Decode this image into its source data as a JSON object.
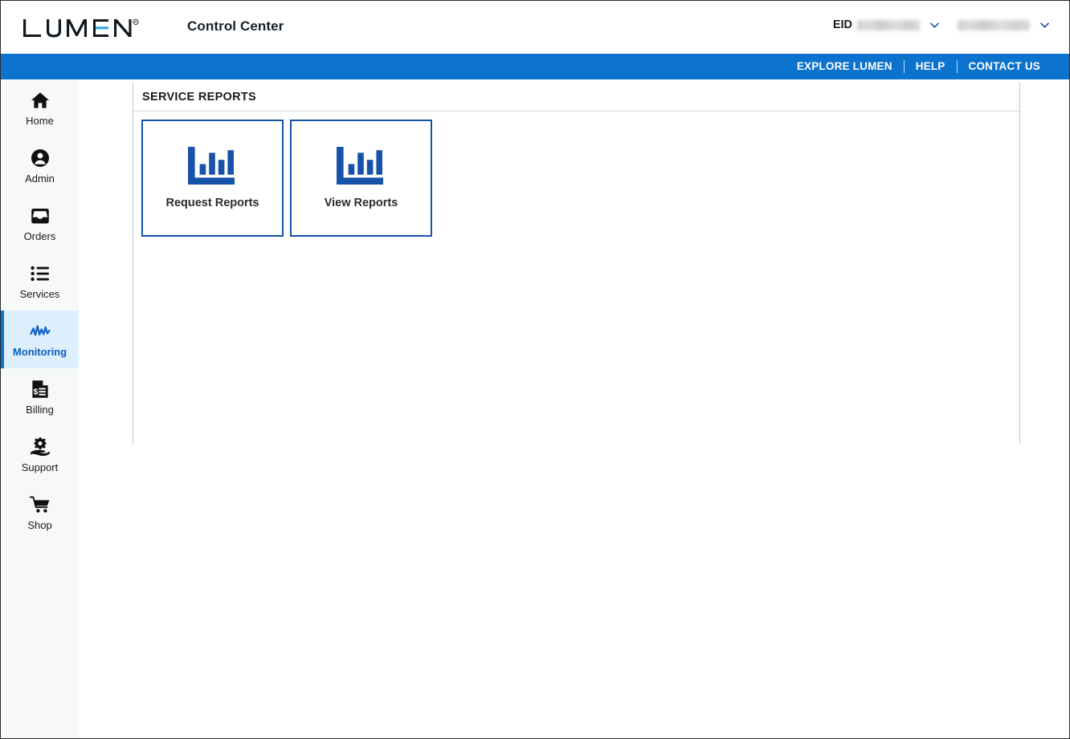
{
  "header": {
    "logo_text": "LUMEN",
    "logo_registered": "®",
    "app_title": "Control Center",
    "eid_label": "EID",
    "eid_value": "",
    "user_value": "",
    "eid_caret": "chevron-down-icon",
    "user_caret": "chevron-down-icon"
  },
  "utility_nav": {
    "items": [
      {
        "label": "EXPLORE LUMEN"
      },
      {
        "label": "HELP"
      },
      {
        "label": "CONTACT US"
      }
    ]
  },
  "sidebar": {
    "items": [
      {
        "label": "Home",
        "icon": "home-icon",
        "active": false
      },
      {
        "label": "Admin",
        "icon": "user-circle-icon",
        "active": false
      },
      {
        "label": "Orders",
        "icon": "inbox-tray-icon",
        "active": false
      },
      {
        "label": "Services",
        "icon": "list-icon",
        "active": false
      },
      {
        "label": "Monitoring",
        "icon": "pulse-line-icon",
        "active": true
      },
      {
        "label": "Billing",
        "icon": "invoice-document-icon",
        "active": false
      },
      {
        "label": "Support",
        "icon": "gear-on-hand-icon",
        "active": false
      },
      {
        "label": "Shop",
        "icon": "shopping-cart-icon",
        "active": false
      }
    ]
  },
  "main": {
    "panel_title": "SERVICE REPORTS",
    "tiles": [
      {
        "label": "Request Reports",
        "icon": "bar-chart-icon"
      },
      {
        "label": "View Reports",
        "icon": "bar-chart-icon"
      }
    ]
  },
  "colors": {
    "brand_blue": "#0b72ce",
    "tile_border_blue": "#1652a8",
    "active_bg": "#ddeefc",
    "sidebar_bg": "#f7f8f8",
    "logo_accent": "#37a5e0"
  }
}
